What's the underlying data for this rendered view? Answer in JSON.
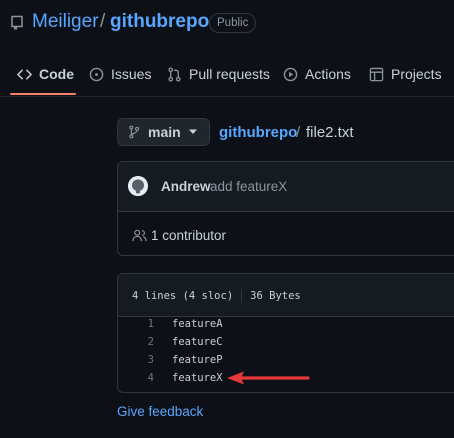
{
  "repo": {
    "owner": "Meiliger",
    "separator": "/",
    "name": "githubrepo",
    "visibility": "Public"
  },
  "nav": {
    "tabs": [
      {
        "label": "Code",
        "icon": "code-icon",
        "active": true
      },
      {
        "label": "Issues",
        "icon": "issue-icon"
      },
      {
        "label": "Pull requests",
        "icon": "pull-request-icon"
      },
      {
        "label": "Actions",
        "icon": "actions-play-icon"
      },
      {
        "label": "Projects",
        "icon": "projects-table-icon"
      }
    ]
  },
  "branch": {
    "label": "main",
    "icon": "git-branch-icon"
  },
  "breadcrumb": {
    "repo": "githubrepo",
    "separator": "/",
    "file": "file2.txt"
  },
  "commit": {
    "author": "Andrew",
    "message": "add featureX",
    "contributors": "1 contributor"
  },
  "file": {
    "lines_info": "4 lines (4 sloc)",
    "size": "36 Bytes",
    "lines": [
      {
        "num": "1",
        "code": "featureA"
      },
      {
        "num": "2",
        "code": "featureC"
      },
      {
        "num": "3",
        "code": "featureP"
      },
      {
        "num": "4",
        "code": "featureX"
      }
    ]
  },
  "annotation": {
    "color": "#e5383b"
  },
  "feedback": "Give feedback",
  "colors": {
    "background": "#0d1117",
    "link": "#58a6ff",
    "active_tab_underline": "#f78166",
    "border": "#30363d"
  }
}
